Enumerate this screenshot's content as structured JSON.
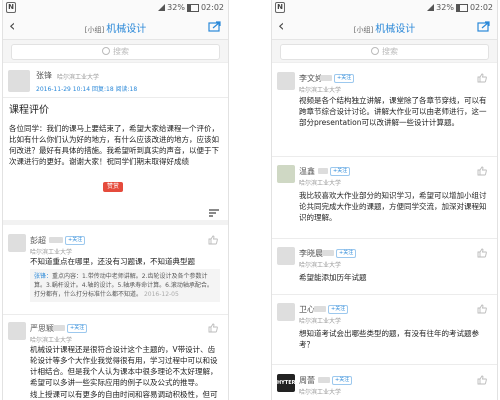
{
  "status": {
    "sim": "N",
    "battery": "32%",
    "time": "02:02"
  },
  "left": {
    "nav": {
      "bracket": "[小组]",
      "title": "机械设计"
    },
    "search": {
      "placeholder": "搜索"
    },
    "post": {
      "author": "张锋",
      "school": "哈尔滨工业大学",
      "meta": "2016-11-29 10:14   回复:18   阅读:18",
      "title": "课程评价",
      "body": "各位同学：我们的课马上要结束了，希望大家给课程一个评价，比如有什么你们认为好的地方，有什么应该改进的地方，应该如何改进？最好有具体的措施。我希望听到真实的声音，以便于下次课进行的更好。谢谢大家！祝同学们期末取得好成绩",
      "reward": "赞赏"
    },
    "comments": [
      {
        "author": "彭超",
        "tag": "+关注",
        "school": "哈尔滨工业大学",
        "text": "不知道重点在哪里，还没有习题课，不知道典型题",
        "reply_name": "张锋：",
        "reply_text": "重点内容：1.带传动中老师讲解。2.齿轮设计及各个参数计算。3.蜗杆设计。4.轴的设计。5.轴承寿命计算。6.滚动轴承配合。打分都有，什么打分标准什么都不知道。",
        "reply_time": "2016-12-05"
      },
      {
        "author": "严思颖",
        "tag": "+关注",
        "school": "哈尔滨工业大学",
        "text": "机械设计课程还是很符合设计这个主题的，V带设计、齿轮设计等多个大作业我觉得很有用，学习过程中可以和设计相结合。但是我个人认为课本中很多理论不太好理解，希望可以多讲一些实际应用的例子以及公式的推导。",
        "text2": "线上授课可以有更多的自由时间和容易调动积极性，但可"
      }
    ]
  },
  "right": {
    "nav": {
      "bracket": "[小组]",
      "title": "机械设计"
    },
    "search": {
      "placeholder": "搜索"
    },
    "comments": [
      {
        "author": "李文婷",
        "tag": "+关注",
        "school": "哈尔滨工业大学",
        "text": "视频是各个结构独立讲解，课堂除了各章节穿线，可以有跨章节综合设计讨论。讲解大作业可以由老师进行，这一部分presentation可以改讲解一些设计计算题。"
      },
      {
        "author": "温鑫",
        "tag": "+关注",
        "school": "哈尔滨工业大学",
        "text": "我比较喜欢大作业部分的知识学习，希望可以增加小组讨论共同完成大作业的课题，方便同学交流，加深对课程知识的理解。"
      },
      {
        "author": "李晓晨",
        "tag": "+关注",
        "school": "哈尔滨工业大学",
        "text": "希望能添加历年试题"
      },
      {
        "author": "卫心",
        "tag": "+关注",
        "school": "哈尔滨工业大学",
        "text": "想知道考试会出哪些类型的题，有没有往年的考试题参考？"
      },
      {
        "author": "周蕾",
        "tag": "+关注",
        "school": "哈尔滨工业大学",
        "avatar_text": "HYTERS"
      }
    ]
  }
}
